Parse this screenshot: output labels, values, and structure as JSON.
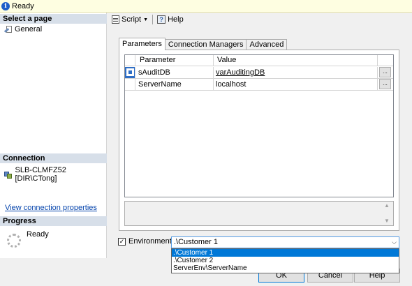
{
  "status": {
    "text": "Ready"
  },
  "left_pane": {
    "select_page_header": "Select a page",
    "pages": [
      {
        "label": "General"
      }
    ],
    "connection_header": "Connection",
    "connection_name": "SLB-CLMFZ52 [DIR\\CTong]",
    "view_connection_link": "View connection properties",
    "progress_header": "Progress",
    "progress_status": "Ready"
  },
  "toolbar": {
    "script_label": "Script",
    "help_label": "Help"
  },
  "tabs": [
    {
      "label": "Parameters",
      "active": true
    },
    {
      "label": "Connection Managers",
      "active": false
    },
    {
      "label": "Advanced",
      "active": false
    }
  ],
  "grid": {
    "headers": {
      "parameter": "Parameter",
      "value": "Value"
    },
    "rows": [
      {
        "parameter": "sAuditDB",
        "value": "varAuditingDB",
        "value_underlined": true,
        "button": "..."
      },
      {
        "parameter": "ServerName",
        "value": "localhost",
        "value_underlined": false,
        "button": "..."
      }
    ]
  },
  "environment": {
    "checked": true,
    "label": "Environment:",
    "selected": ".\\Customer 1",
    "options": [
      ".\\Customer 1",
      ".\\Customer 2",
      "ServerEnv\\ServerName"
    ]
  },
  "buttons": {
    "ok": "OK",
    "cancel": "Cancel",
    "help": "Help"
  },
  "colors": {
    "accent": "#0078d7",
    "section_header": "#d7dfe9",
    "status_bar": "#fefee1"
  }
}
